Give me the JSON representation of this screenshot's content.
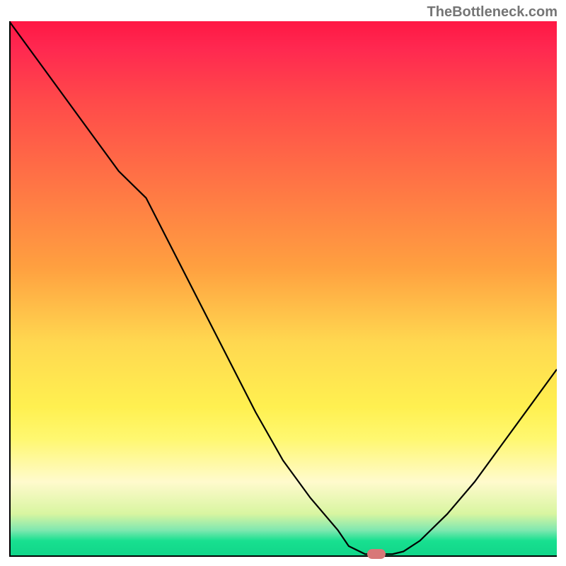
{
  "watermark": "TheBottleneck.com",
  "chart_data": {
    "type": "line",
    "title": "",
    "xlabel": "",
    "ylabel": "",
    "x": [
      0,
      5,
      10,
      15,
      20,
      25,
      30,
      35,
      40,
      45,
      50,
      55,
      60,
      62,
      65,
      68,
      70,
      72,
      75,
      80,
      85,
      90,
      95,
      100
    ],
    "y": [
      100,
      93,
      86,
      79,
      72,
      67,
      57,
      47,
      37,
      27,
      18,
      11,
      5,
      2,
      0.5,
      0.5,
      0.5,
      1,
      3,
      8,
      14,
      21,
      28,
      35
    ],
    "xlim": [
      0,
      100
    ],
    "ylim": [
      0,
      100
    ],
    "marker_position": {
      "x": 67,
      "y": 0.5
    },
    "background_gradient": {
      "top_color": "#ff1744",
      "mid_color": "#ffd850",
      "bottom_color": "#10d488",
      "meaning": "red=high bottleneck, yellow=moderate, green=optimal"
    },
    "annotations": []
  },
  "colors": {
    "curve": "#000000",
    "marker": "#d87878",
    "axis": "#000000",
    "watermark": "#757575"
  }
}
